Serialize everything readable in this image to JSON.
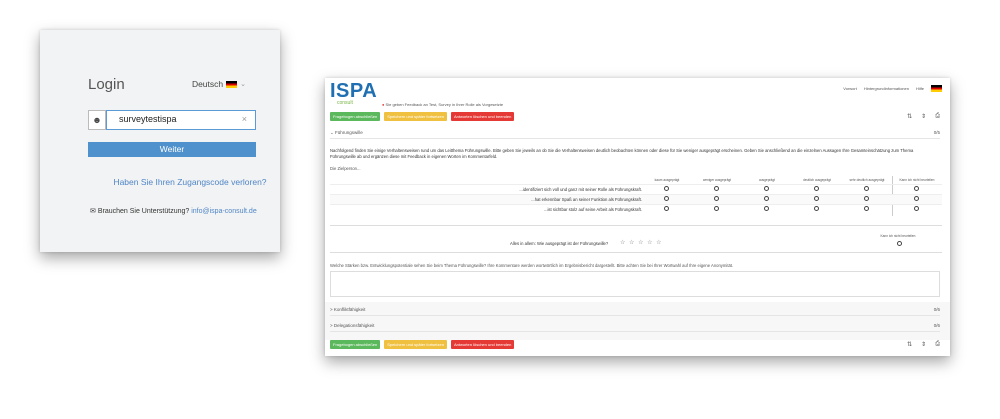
{
  "login": {
    "title": "Login",
    "language": "Deutsch",
    "username_value": "surveytestispa",
    "clear_glyph": "×",
    "submit_label": "Weiter",
    "lost_code_link": "Haben Sie Ihren Zugangscode verloren?",
    "support_text": "Brauchen Sie Unterstützung?",
    "support_email": "info@ispa-consult.de"
  },
  "survey": {
    "logo": "ISPA",
    "logo_sub": "consult",
    "header_info": "Sie geben Feedback an Test, Survey in Ihrer Rolle als Vorgesetzte",
    "top_links": [
      "Vorwort",
      "Hintergrundinformationen",
      "Hilfe"
    ],
    "buttons": {
      "finish": "Fragebogen abschließen",
      "save_later": "Speichern und später fortsetzen",
      "delete_send": "Antworten löschen und beenden"
    },
    "section1": {
      "title": "Führungswille",
      "score": "0/5"
    },
    "intro": "Nachfolgend finden Sie einige Verhaltensweisen rund um das Leitthema Führungswille. Bitte geben Sie jeweils an ob Sie die Verhaltensweisen deutlich beobachten können oder diese für Sie weniger ausgeprägt erscheinen. Geben Sie anschließend an die einzelnen Aussagen Ihre Gesamteinschätzung zum Thema Führungswille ab und ergänzen diese mit Feedback in eigenen Worten im Kommentarfeld.",
    "person_label": "Die Zielperson...",
    "columns": [
      "kaum ausgeprägt",
      "weniger ausgeprägt",
      "ausgeprägt",
      "deutlich ausgeprägt",
      "sehr deutlich ausgeprägt",
      "Kann ich nicht beurteilen"
    ],
    "statements": [
      "...identifiziert sich voll und ganz mit seiner Rolle als Führungskraft.",
      "...hat erkennbar Spaß an seiner Funktion als Führungskraft.",
      "...ist sichtbar stolz auf seine Arbeit als Führungskraft."
    ],
    "overall_question": "Alles in allem: Wie ausgeprägt ist der Führungswille?",
    "stars": "☆ ☆ ☆ ☆ ☆",
    "overall_cannot_judge": "Kann ich nicht beurteilen",
    "comment_question": "Welche Stärken bzw. Entwicklungspotentiale sehen Sie beim Thema Führungswille? Ihre Kommentare werden wortwörtlich im Ergebnisbericht dargestellt. Bitte achten Sie bei Ihrer Wortwahl auf Ihre eigene Anonymität.",
    "section2": {
      "title": "Konfliktfähigkeit",
      "score": "0/6"
    },
    "section3": {
      "title": "Delegationsfähigkeit",
      "score": "0/6"
    }
  }
}
